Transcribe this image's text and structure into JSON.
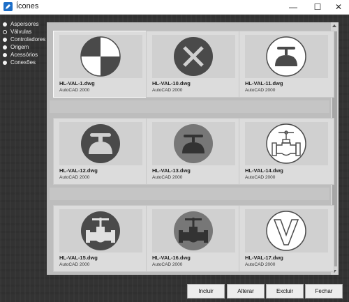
{
  "window": {
    "title": "Ícones",
    "controls": {
      "minimize": "—",
      "maximize": "☐",
      "close": "✕"
    }
  },
  "sidebar": {
    "categories": [
      {
        "label": "Aspersores",
        "selected": false
      },
      {
        "label": "Válvulas",
        "selected": true
      },
      {
        "label": "Controladores",
        "selected": false
      },
      {
        "label": "Origem",
        "selected": false
      },
      {
        "label": "Acessórios",
        "selected": false
      },
      {
        "label": "Conexões",
        "selected": false
      }
    ]
  },
  "icons": [
    {
      "name": "HL-VAL-1.dwg",
      "version": "AutoCAD 2000",
      "selected": true
    },
    {
      "name": "HL-VAL-10.dwg",
      "version": "AutoCAD 2000",
      "selected": false
    },
    {
      "name": "HL-VAL-11.dwg",
      "version": "AutoCAD 2000",
      "selected": false
    },
    {
      "name": "HL-VAL-12.dwg",
      "version": "AutoCAD 2000",
      "selected": false
    },
    {
      "name": "HL-VAL-13.dwg",
      "version": "AutoCAD 2000",
      "selected": false
    },
    {
      "name": "HL-VAL-14.dwg",
      "version": "AutoCAD 2000",
      "selected": false
    },
    {
      "name": "HL-VAL-15.dwg",
      "version": "AutoCAD 2000",
      "selected": false
    },
    {
      "name": "HL-VAL-16.dwg",
      "version": "AutoCAD 2000",
      "selected": false
    },
    {
      "name": "HL-VAL-17.dwg",
      "version": "AutoCAD 2000",
      "selected": false
    }
  ],
  "buttons": {
    "include": "Incluir",
    "edit": "Alterar",
    "delete": "Excluir",
    "close": "Fechar"
  }
}
